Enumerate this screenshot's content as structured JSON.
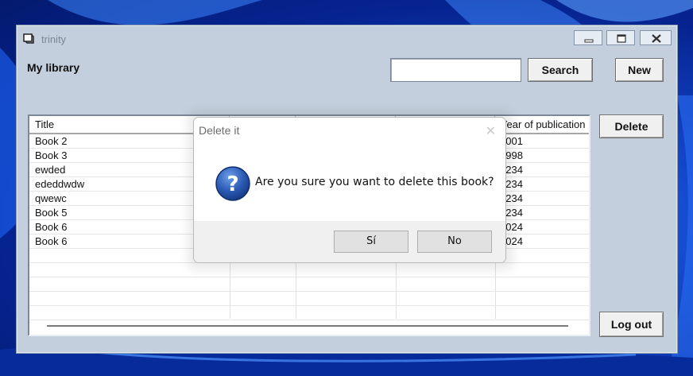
{
  "window": {
    "title": "trinity"
  },
  "main": {
    "library_label": "My library",
    "search": {
      "value": "",
      "placeholder": "",
      "button_label": "Search"
    },
    "new_label": "New",
    "delete_label": "Delete",
    "logout_label": "Log out"
  },
  "table": {
    "columns": [
      "Title",
      "",
      "",
      "",
      "Year of publication"
    ],
    "rows": [
      {
        "title": "Book 2",
        "year": "2001"
      },
      {
        "title": "Book 3",
        "year": "1998"
      },
      {
        "title": "ewded",
        "year": "1234"
      },
      {
        "title": "ededdwdw",
        "year": "1234"
      },
      {
        "title": "qwewc",
        "year": "1234"
      },
      {
        "title": "Book 5",
        "year": "1234"
      },
      {
        "title": "Book 6",
        "year": "2024"
      },
      {
        "title": "Book 6",
        "year": "2024"
      }
    ]
  },
  "dialog": {
    "title": "Delete it",
    "message": "Are you sure you want to delete this book?",
    "yes_label": "Sí",
    "no_label": "No",
    "icon": "question-icon"
  },
  "colors": {
    "window_bg": "#c3cfdc",
    "dialog_icon_blue": "#2b5bb5",
    "wallpaper_blue": "#1246c9"
  }
}
